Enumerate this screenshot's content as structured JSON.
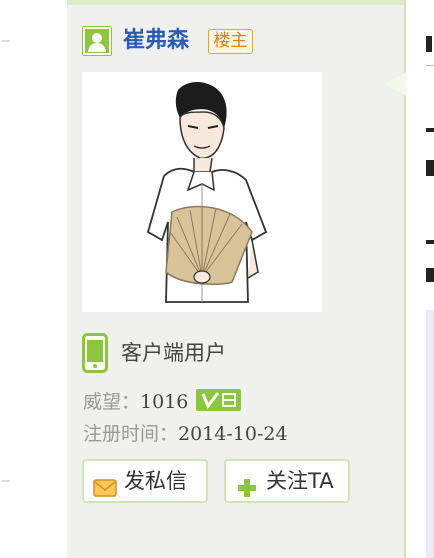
{
  "user": {
    "name": "崔弗森",
    "owner_badge": "楼主",
    "client_label": "客户端用户",
    "prestige_label": "威望：",
    "prestige_value": "1016",
    "verified_badge": "V日",
    "register_label": "注册时间：",
    "register_value": "2014-10-24"
  },
  "actions": {
    "message_label": "发私信",
    "follow_label": "关注TA"
  },
  "icons": {
    "user": "user-icon",
    "phone": "phone-icon",
    "mail": "mail-icon",
    "plus": "plus-icon",
    "verified": "verified-v-icon"
  },
  "colors": {
    "accent_green": "#8cc63f",
    "username_blue": "#2a5db0",
    "badge_orange": "#e57c1a",
    "sidebar_bg": "#f0f0ee"
  }
}
